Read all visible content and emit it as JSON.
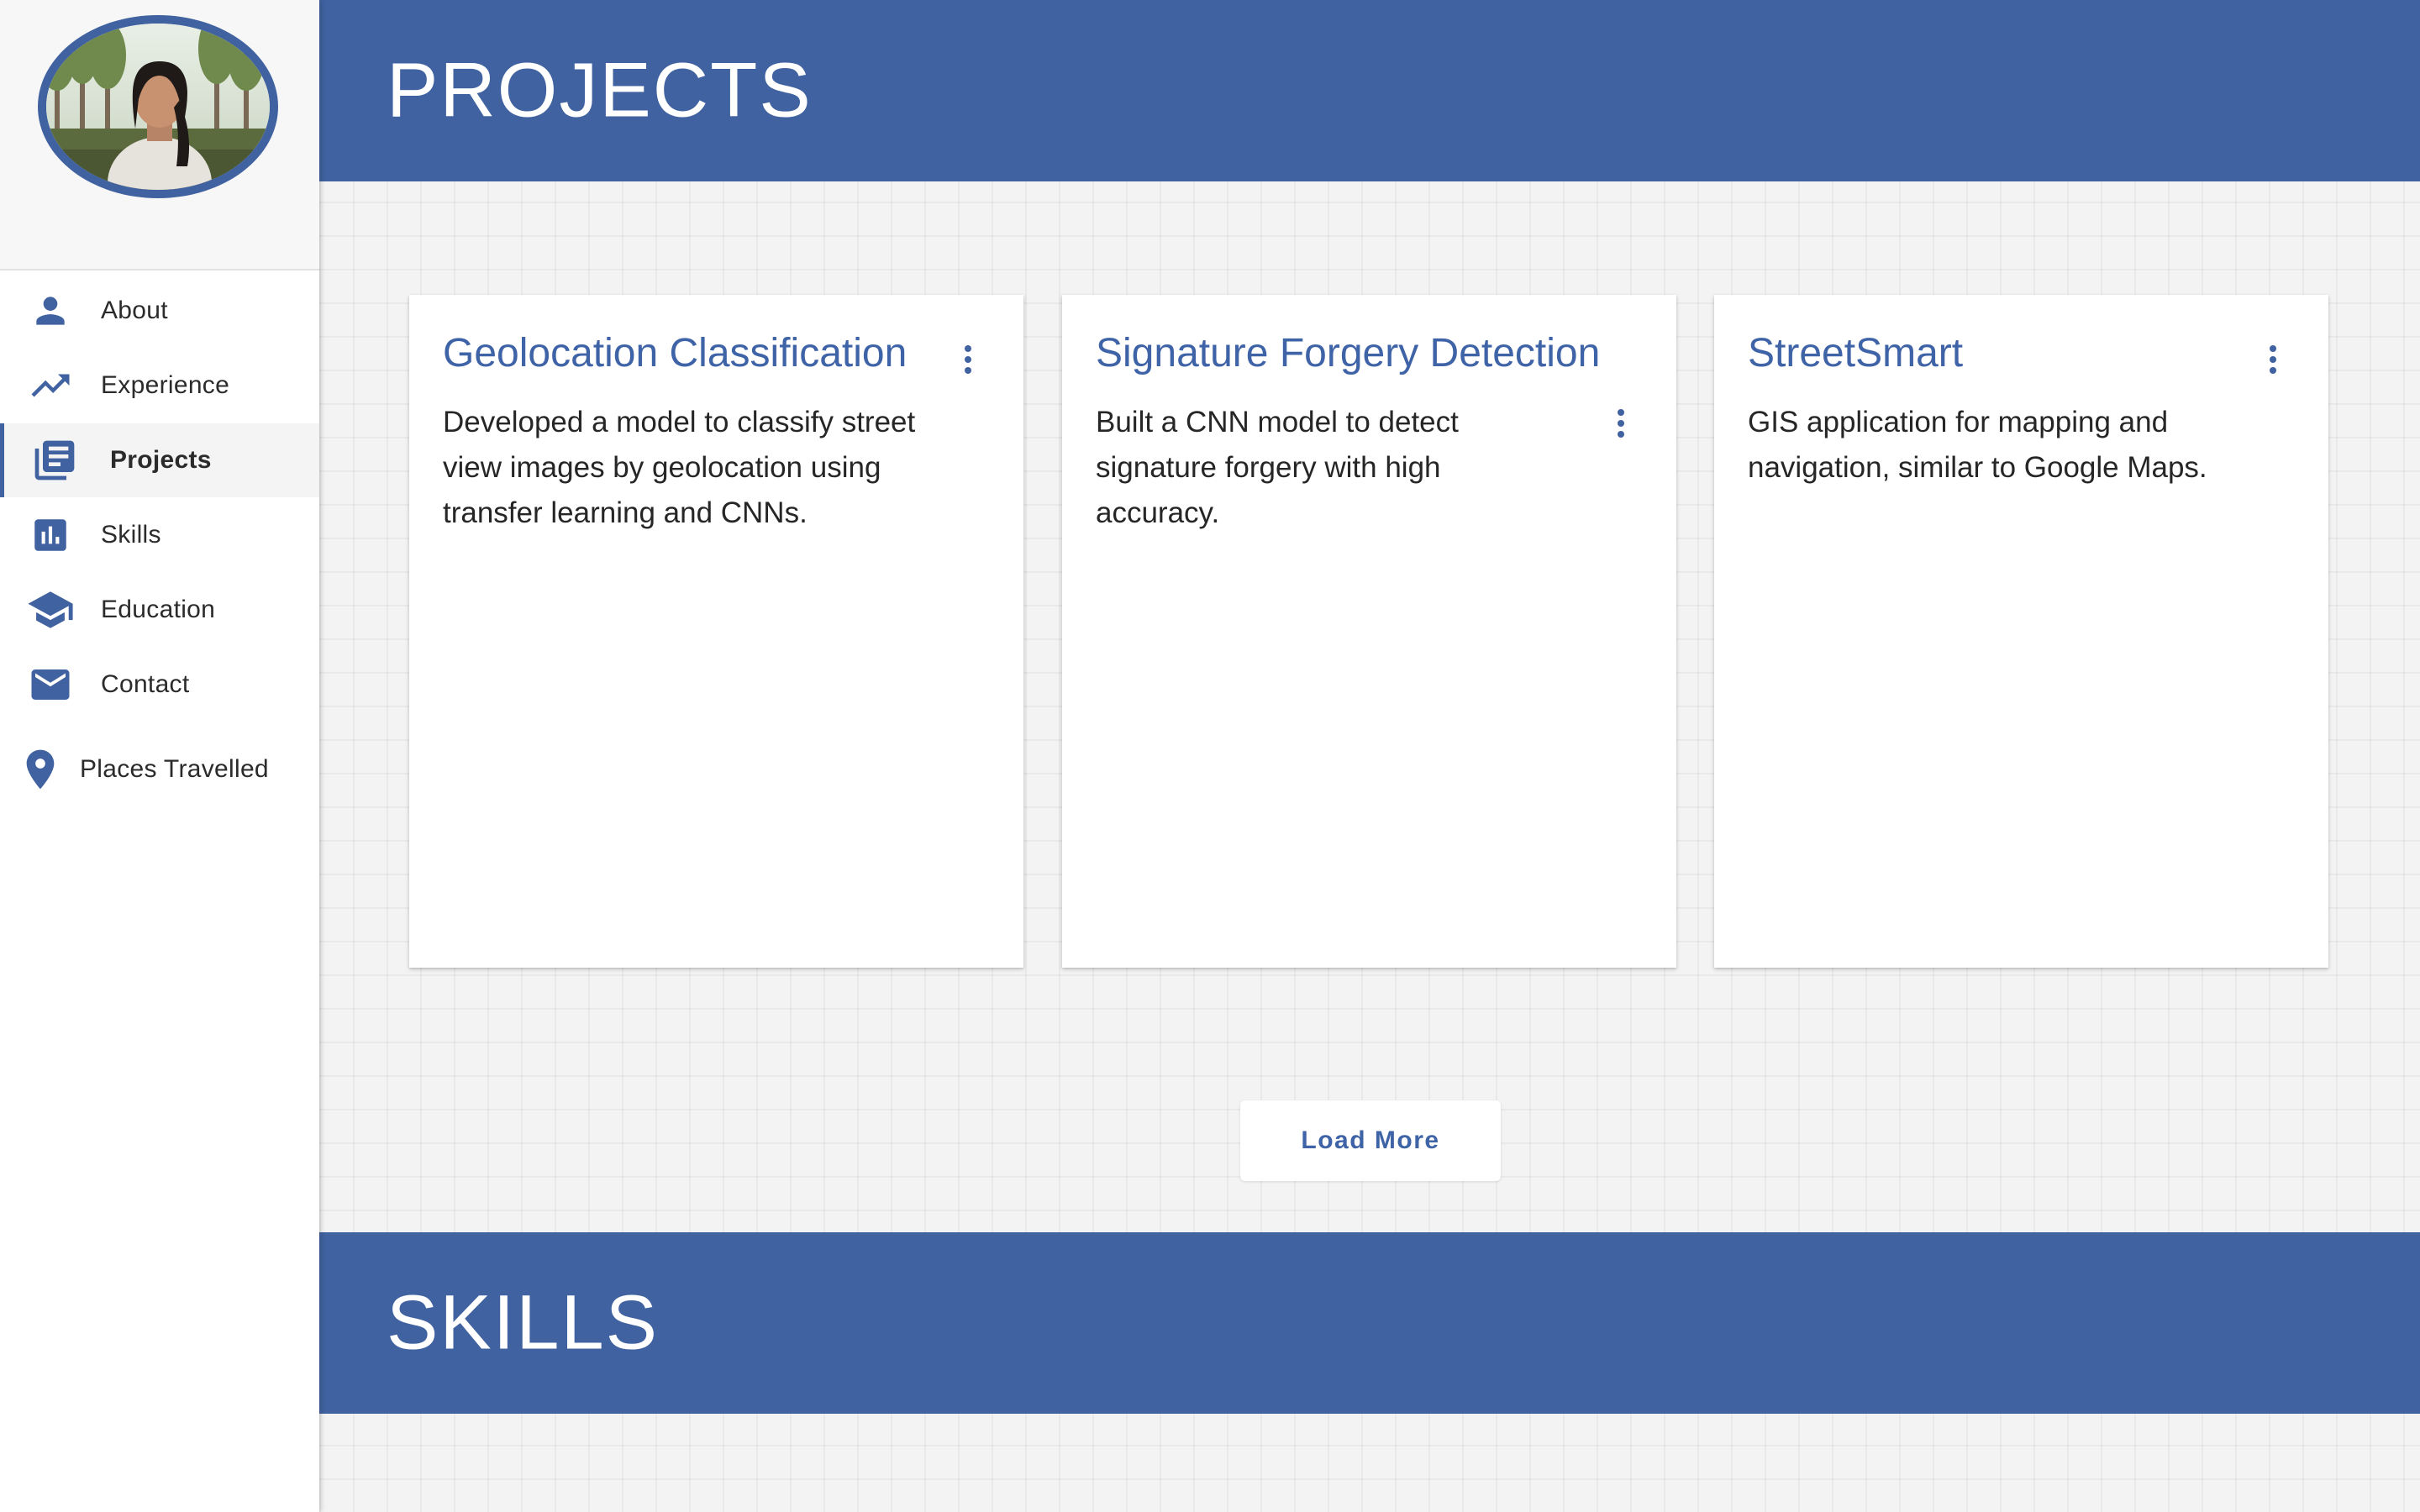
{
  "sidebar": {
    "avatar_alt": "profile photo",
    "items": [
      {
        "label": "About",
        "icon": "person-icon"
      },
      {
        "label": "Experience",
        "icon": "trending-up-icon"
      },
      {
        "label": "Projects",
        "icon": "article-icon",
        "active": true
      },
      {
        "label": "Skills",
        "icon": "bar-chart-icon"
      },
      {
        "label": "Education",
        "icon": "graduation-cap-icon"
      },
      {
        "label": "Contact",
        "icon": "mail-icon"
      },
      {
        "label": "Places Travelled",
        "icon": "location-pin-icon"
      }
    ]
  },
  "main": {
    "projects_title": "PROJECTS",
    "skills_title": "SKILLS",
    "cards": [
      {
        "title": "Geolocation Classification",
        "description": "Developed a model to classify street view images by geolocation using transfer learning and CNNs."
      },
      {
        "title": "Signature Forgery Detection",
        "description": "Built a CNN model to detect signature forgery with high accuracy."
      },
      {
        "title": "StreetSmart",
        "description": "GIS application for mapping and navigation, similar to Google Maps."
      }
    ],
    "load_more_label": "Load More"
  },
  "colors": {
    "accent": "#4062a0",
    "title_blue": "#3f63a7",
    "background": "#f3f3f3",
    "card": "#ffffff"
  }
}
